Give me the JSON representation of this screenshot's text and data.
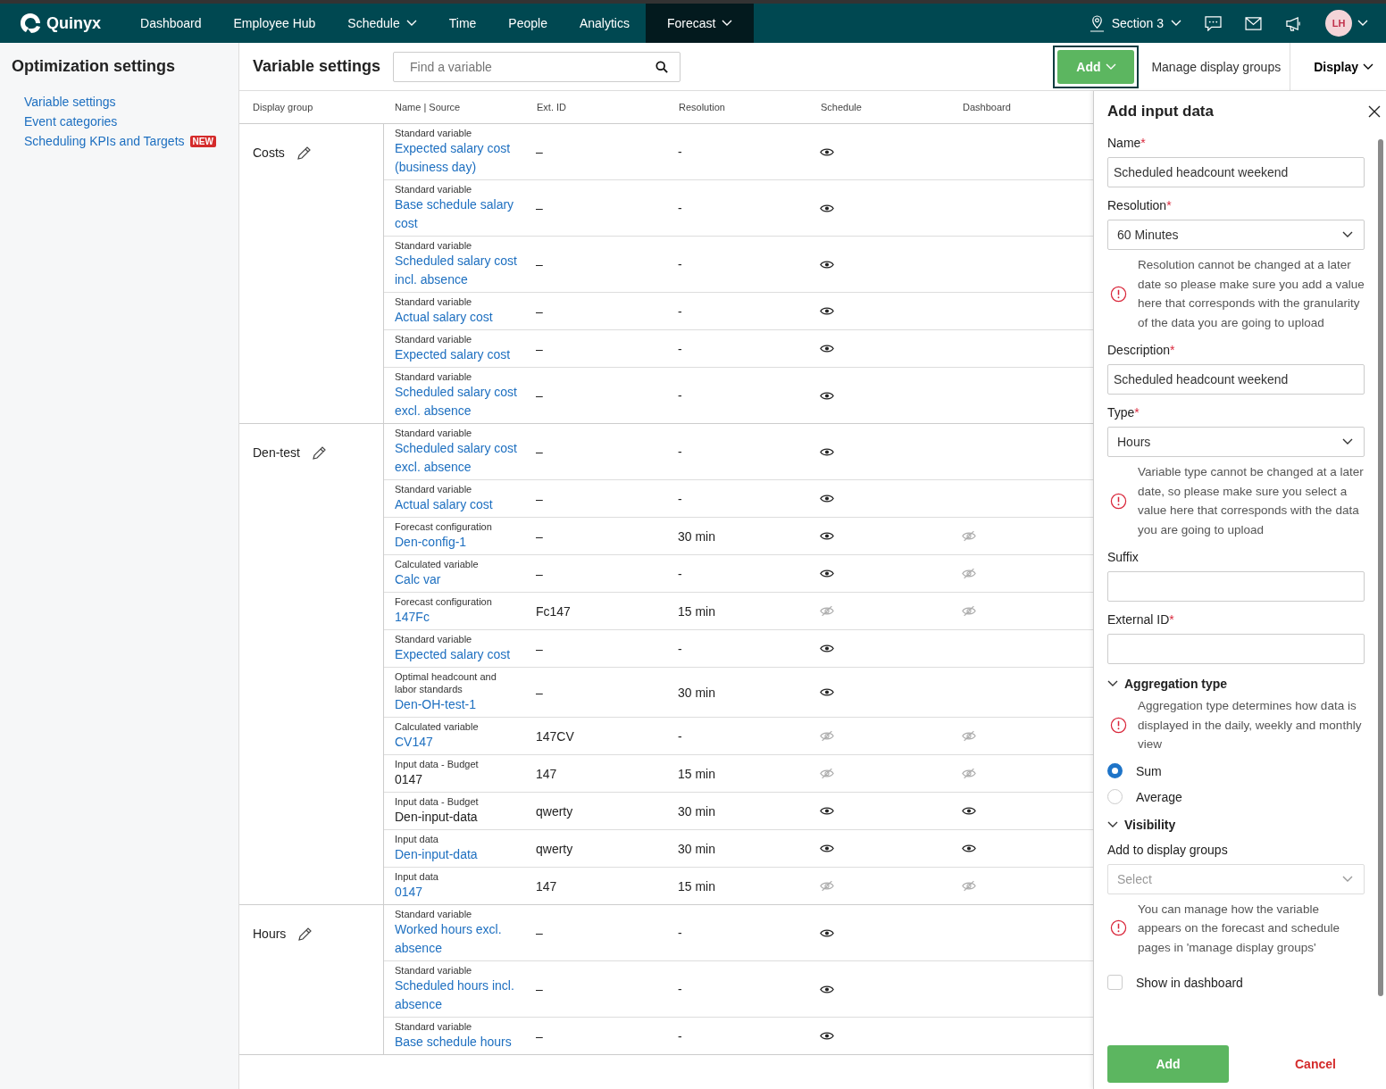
{
  "topbar": {
    "logo": "Quinyx",
    "nav": [
      {
        "label": "Dashboard",
        "dropdown": false,
        "selected": false
      },
      {
        "label": "Employee Hub",
        "dropdown": false,
        "selected": false
      },
      {
        "label": "Schedule",
        "dropdown": true,
        "selected": false
      },
      {
        "label": "Time",
        "dropdown": false,
        "selected": false
      },
      {
        "label": "People",
        "dropdown": false,
        "selected": false
      },
      {
        "label": "Analytics",
        "dropdown": false,
        "selected": false
      },
      {
        "label": "Forecast",
        "dropdown": true,
        "selected": true
      }
    ],
    "section": "Section 3",
    "avatar": "LH"
  },
  "sidebar": {
    "title": "Optimization settings",
    "items": [
      {
        "label": "Variable settings"
      },
      {
        "label": "Event categories"
      },
      {
        "label": "Scheduling KPIs and Targets",
        "badge": "NEW"
      }
    ]
  },
  "toolbar": {
    "title": "Variable settings",
    "search": {
      "placeholder": "Find a variable"
    },
    "add_button": "Add",
    "manage_link": "Manage display groups",
    "display_button": "Display"
  },
  "table": {
    "columns": [
      "Display group",
      "Name | Source",
      "Ext. ID",
      "Resolution",
      "Schedule",
      "Dashboard"
    ],
    "groups": [
      {
        "name": "Costs",
        "rows": [
          {
            "source": "Standard variable",
            "name": "Expected salary cost (business day)",
            "link": true,
            "ext_id": "–",
            "resolution": "-",
            "schedule_visible": true
          },
          {
            "source": "Standard variable",
            "name": "Base schedule salary cost",
            "link": true,
            "ext_id": "–",
            "resolution": "-",
            "schedule_visible": true
          },
          {
            "source": "Standard variable",
            "name": "Scheduled salary cost incl. absence",
            "link": true,
            "ext_id": "–",
            "resolution": "-",
            "schedule_visible": true
          },
          {
            "source": "Standard variable",
            "name": "Actual salary cost",
            "link": true,
            "ext_id": "–",
            "resolution": "-",
            "schedule_visible": true
          },
          {
            "source": "Standard variable",
            "name": "Expected salary cost",
            "link": true,
            "ext_id": "–",
            "resolution": "-",
            "schedule_visible": true
          },
          {
            "source": "Standard variable",
            "name": "Scheduled salary cost excl. absence",
            "link": true,
            "ext_id": "–",
            "resolution": "-",
            "schedule_visible": true
          }
        ]
      },
      {
        "name": "Den-test",
        "rows": [
          {
            "source": "Standard variable",
            "name": "Scheduled salary cost excl. absence",
            "link": true,
            "ext_id": "–",
            "resolution": "-",
            "schedule_visible": true
          },
          {
            "source": "Standard variable",
            "name": "Actual salary cost",
            "link": true,
            "ext_id": "–",
            "resolution": "-",
            "schedule_visible": true
          },
          {
            "source": "Forecast configuration",
            "name": "Den-config-1",
            "link": true,
            "ext_id": "–",
            "resolution": "30 min",
            "schedule_visible": true,
            "dashboard_visible": false
          },
          {
            "source": "Calculated variable",
            "name": "Calc var",
            "link": true,
            "ext_id": "–",
            "resolution": "-",
            "schedule_visible": true,
            "dashboard_visible": false
          },
          {
            "source": "Forecast configuration",
            "name": "147Fc",
            "link": true,
            "ext_id": "Fc147",
            "resolution": "15 min",
            "schedule_visible": false,
            "dashboard_visible": false
          },
          {
            "source": "Standard variable",
            "name": "Expected salary cost",
            "link": true,
            "ext_id": "–",
            "resolution": "-",
            "schedule_visible": true
          },
          {
            "source": "Optimal headcount and labor standards",
            "name": "Den-OH-test-1",
            "link": true,
            "ext_id": "–",
            "resolution": "30 min",
            "schedule_visible": true
          },
          {
            "source": "Calculated variable",
            "name": "CV147",
            "link": true,
            "ext_id": "147CV",
            "resolution": "-",
            "schedule_visible": false,
            "dashboard_visible": false
          },
          {
            "source": "Input data - Budget",
            "name": "0147",
            "link": false,
            "ext_id": "147",
            "resolution": "15 min",
            "schedule_visible": false,
            "dashboard_visible": false
          },
          {
            "source": "Input data - Budget",
            "name": "Den-input-data",
            "link": false,
            "ext_id": "qwerty",
            "resolution": "30 min",
            "schedule_visible": true,
            "dashboard_visible": true
          },
          {
            "source": "Input data",
            "name": "Den-input-data",
            "link": true,
            "ext_id": "qwerty",
            "resolution": "30 min",
            "schedule_visible": true,
            "dashboard_visible": true
          },
          {
            "source": "Input data",
            "name": "0147",
            "link": true,
            "ext_id": "147",
            "resolution": "15 min",
            "schedule_visible": false,
            "dashboard_visible": false
          }
        ]
      },
      {
        "name": "Hours",
        "rows": [
          {
            "source": "Standard variable",
            "name": "Worked hours excl. absence",
            "link": true,
            "ext_id": "–",
            "resolution": "-",
            "schedule_visible": true
          },
          {
            "source": "Standard variable",
            "name": "Scheduled hours incl. absence",
            "link": true,
            "ext_id": "–",
            "resolution": "-",
            "schedule_visible": true
          },
          {
            "source": "Standard variable",
            "name": "Base schedule hours",
            "link": true,
            "ext_id": "–",
            "resolution": "-",
            "schedule_visible": true
          }
        ]
      }
    ]
  },
  "panel": {
    "title": "Add input data",
    "items": [
      {
        "kind": "text",
        "label": "Name",
        "required_mark": "*",
        "value": "Scheduled headcount weekend"
      },
      {
        "kind": "select",
        "label": "Resolution",
        "required_mark": "*",
        "value": "60 Minutes"
      },
      {
        "kind": "note",
        "text": "Resolution cannot be changed at a later date so please make sure you add a value here that corresponds with the granularity of the data you are going to upload"
      },
      {
        "kind": "text",
        "label": "Description",
        "required_mark": "*",
        "value": "Scheduled headcount weekend"
      },
      {
        "kind": "select",
        "label": "Type",
        "required_mark": "*",
        "value": "Hours"
      },
      {
        "kind": "note",
        "text": "Variable type cannot be changed at a later date, so please make sure you select a value here that corresponds with the data you are going to upload"
      },
      {
        "kind": "text",
        "label": "Suffix"
      },
      {
        "kind": "text",
        "label": "External ID",
        "required_mark": "*"
      },
      {
        "kind": "section",
        "title": "Aggregation type",
        "expanded": true
      },
      {
        "kind": "note",
        "text": "Aggregation type determines how data is displayed in the daily, weekly and monthly view"
      },
      {
        "kind": "radio",
        "options": [
          {
            "label": "Sum",
            "selected": true
          },
          {
            "label": "Average",
            "selected": false
          }
        ]
      },
      {
        "kind": "section",
        "title": "Visibility",
        "expanded": true
      },
      {
        "kind": "select",
        "label": "Add to display groups",
        "placeholder": "Select",
        "disabled": true
      },
      {
        "kind": "note",
        "text": "You can manage how the variable appears on the forecast and schedule pages in 'manage display groups'"
      },
      {
        "kind": "checkbox",
        "label": "Show in dashboard",
        "checked": false
      }
    ],
    "primary_button": "Add",
    "cancel_button": "Cancel"
  }
}
